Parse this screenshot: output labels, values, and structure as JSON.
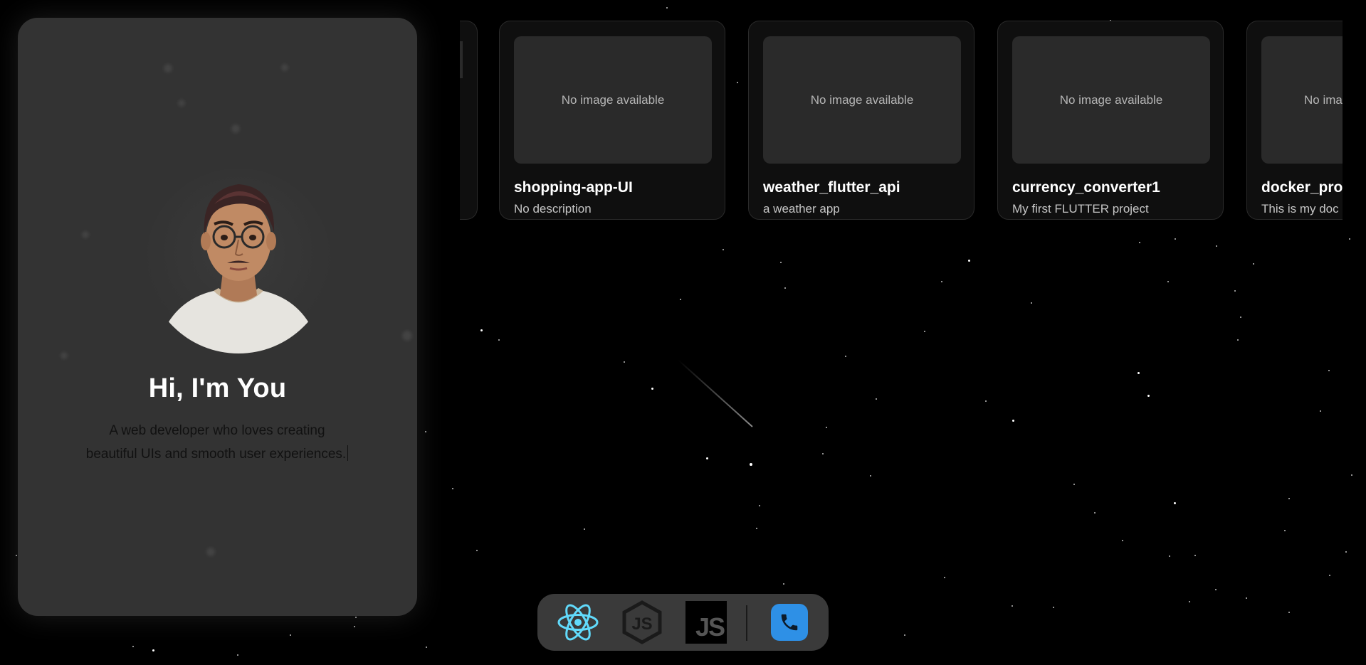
{
  "profile": {
    "title": "Hi, I'm You",
    "description_line1": "A web developer who loves creating",
    "description_line2": "beautiful UIs and smooth user experiences."
  },
  "repos": [
    {
      "name": "shopping-app-UI",
      "description": "No description",
      "image_placeholder": "No image available"
    },
    {
      "name": "weather_flutter_api",
      "description": "a weather app",
      "image_placeholder": "No image available"
    },
    {
      "name": "currency_converter1",
      "description": "My first FLUTTER project",
      "image_placeholder": "No image available"
    },
    {
      "name": "docker_pro",
      "description": "This is my doc",
      "image_placeholder": "No ima"
    }
  ],
  "dock": {
    "items": [
      {
        "icon": "react-icon",
        "color": "#61dafb"
      },
      {
        "icon": "nodejs-icon",
        "color": "#1a1a1a"
      },
      {
        "icon": "javascript-icon",
        "color": "#000000"
      },
      {
        "icon": "phone-icon",
        "color": "#2e90e6"
      }
    ]
  },
  "colors": {
    "background": "#000000",
    "card": "#333333",
    "repo_card": "#0f0f0f",
    "thumb": "#2a2a2a",
    "accent_blue": "#2e90e6",
    "react_cyan": "#61dafb"
  }
}
